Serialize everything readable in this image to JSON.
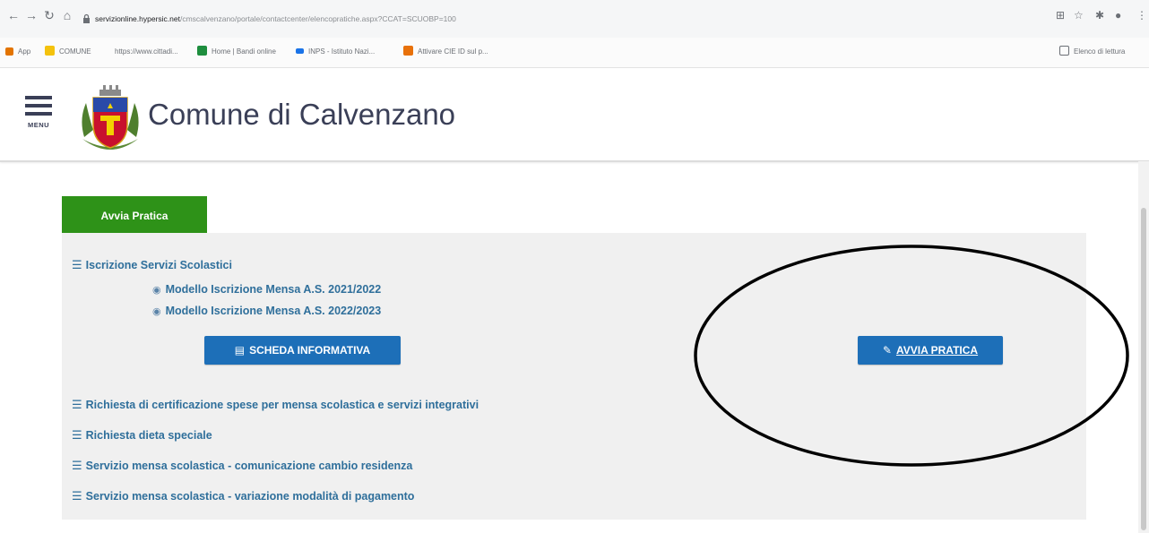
{
  "browser": {
    "url_host": "servizionline.hypersic.net",
    "url_path": "/cmscalvenzano/portale/contactcenter/elencopratiche.aspx?CCAT=SCUOBP=100",
    "bookmarks": [
      {
        "label": "App",
        "color": "#e37400"
      },
      {
        "label": "COMUNE",
        "color": "#f4c20d"
      },
      {
        "label": "https://www.cittadi...",
        "color": ""
      },
      {
        "label": "Home | Bandi online",
        "color": "#1e8e3e"
      },
      {
        "label": "INPS - Istituto Nazi...",
        "color": "#1a73e8"
      },
      {
        "label": "Attivare CIE ID sul p...",
        "color": "#e8710a"
      }
    ],
    "reading_list": "Elenco di lettura"
  },
  "header": {
    "menu_label": "MENU",
    "title": "Comune di Calvenzano"
  },
  "tabs": {
    "active_label": "Avvia Pratica"
  },
  "panel": {
    "category": "Iscrizione Servizi Scolastici",
    "sub_items": [
      "Modello Iscrizione Mensa A.S. 2021/2022",
      "Modello Iscrizione Mensa A.S. 2022/2023"
    ],
    "scheda_button": "SCHEDA INFORMATIVA",
    "avvia_button": "AVVIA PRATICA",
    "other_links": [
      "Richiesta di certificazione spese per mensa scolastica e servizi integrativi",
      "Richiesta dieta speciale",
      "Servizio mensa scolastica - comunicazione cambio residenza",
      "Servizio mensa scolastica - variazione modalità di pagamento"
    ]
  },
  "colors": {
    "tab_green": "#2e9218",
    "button_blue": "#1d6fb8",
    "link_blue": "#2f6f9b",
    "title_navy": "#3a3f57"
  }
}
